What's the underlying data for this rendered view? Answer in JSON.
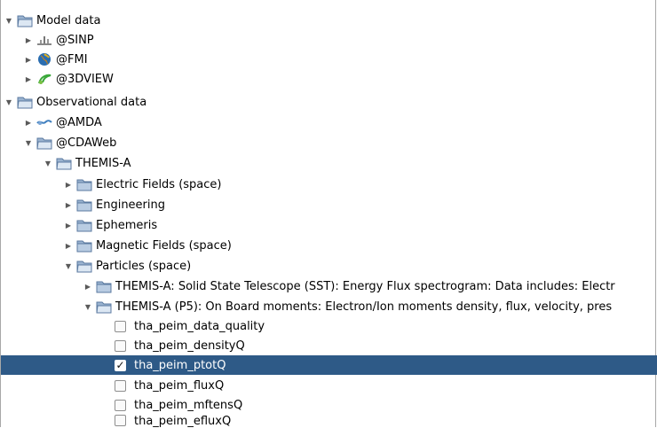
{
  "tree": {
    "model_data": {
      "label": "Model data"
    },
    "sinp": {
      "label": "@SINP"
    },
    "fmi": {
      "label": "@FMI"
    },
    "threedview": {
      "label": "@3DVIEW"
    },
    "observational_data": {
      "label": "Observational data"
    },
    "amda": {
      "label": "@AMDA"
    },
    "cdaweb": {
      "label": "@CDAWeb"
    },
    "themis_a": {
      "label": "THEMIS-A"
    },
    "electric_fields": {
      "label": "Electric Fields (space)"
    },
    "engineering": {
      "label": "Engineering"
    },
    "ephemeris": {
      "label": "Ephemeris"
    },
    "magnetic_fields": {
      "label": "Magnetic Fields (space)"
    },
    "particles": {
      "label": "Particles (space)"
    },
    "sst": {
      "label": "THEMIS-A:  Solid State Telescope (SST): Energy Flux spectrogram:  Data includes: Electr"
    },
    "p5": {
      "label": "THEMIS-A (P5):  On Board moments:  Electron/Ion moments density, flux, velocity, pres"
    },
    "params": [
      {
        "label": "tha_peim_data_quality",
        "checked": false
      },
      {
        "label": "tha_peim_densityQ",
        "checked": false
      },
      {
        "label": "tha_peim_ptotQ",
        "checked": true
      },
      {
        "label": "tha_peim_fluxQ",
        "checked": false
      },
      {
        "label": "tha_peim_mftensQ",
        "checked": false
      },
      {
        "label": "tha_peim_efluxQ",
        "checked": false
      }
    ],
    "check_mark": "✓"
  },
  "colors": {
    "selection": "#2e5a87",
    "folder": "#8fa8c6"
  }
}
